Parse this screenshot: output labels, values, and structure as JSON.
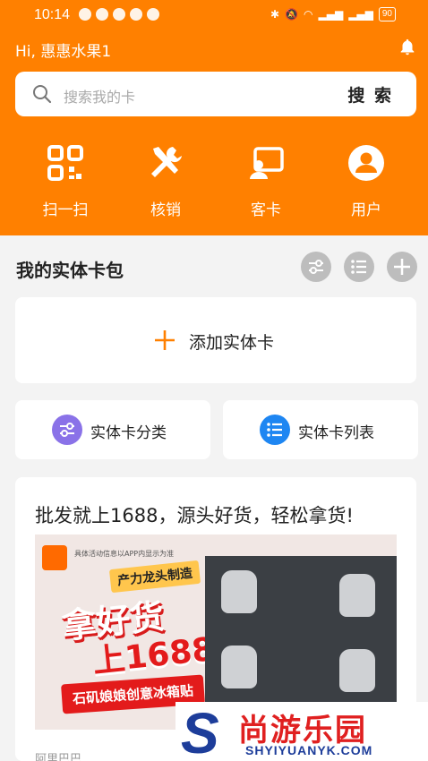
{
  "status_bar": {
    "time": "10:14",
    "battery": "90"
  },
  "header": {
    "greeting": "Hi, 惠惠水果1"
  },
  "search": {
    "placeholder": "搜索我的卡",
    "button_label": "搜 索"
  },
  "quick_actions": [
    {
      "label": "扫一扫",
      "icon": "qr-scan-icon"
    },
    {
      "label": "核销",
      "icon": "tools-icon"
    },
    {
      "label": "客卡",
      "icon": "customer-card-icon"
    },
    {
      "label": "用户",
      "icon": "user-icon"
    }
  ],
  "section": {
    "title": "我的实体卡包"
  },
  "add_card": {
    "label": "添加实体卡"
  },
  "category_buttons": [
    {
      "label": "实体卡分类",
      "icon": "filter-icon",
      "color": "#8a72e8"
    },
    {
      "label": "实体卡列表",
      "icon": "list-icon",
      "color": "#1e86f2"
    }
  ],
  "promo": {
    "title": "批发就上1688，源头好货，轻松拿货!",
    "banner_note": "具体活动信息以APP内显示为准",
    "banner_chip": "产力龙头制造",
    "banner_line1": "拿好货",
    "banner_line2": "上1688",
    "banner_tag": "石矶娘娘创意冰箱贴",
    "footer": "阿里巴巴"
  },
  "watermark": {
    "logo_letter": "S",
    "name": "尚游乐园",
    "domain": "SHYIYUANYK.COM"
  },
  "colors": {
    "brand_orange": "#ff8000",
    "background": "#f3f3f3"
  }
}
